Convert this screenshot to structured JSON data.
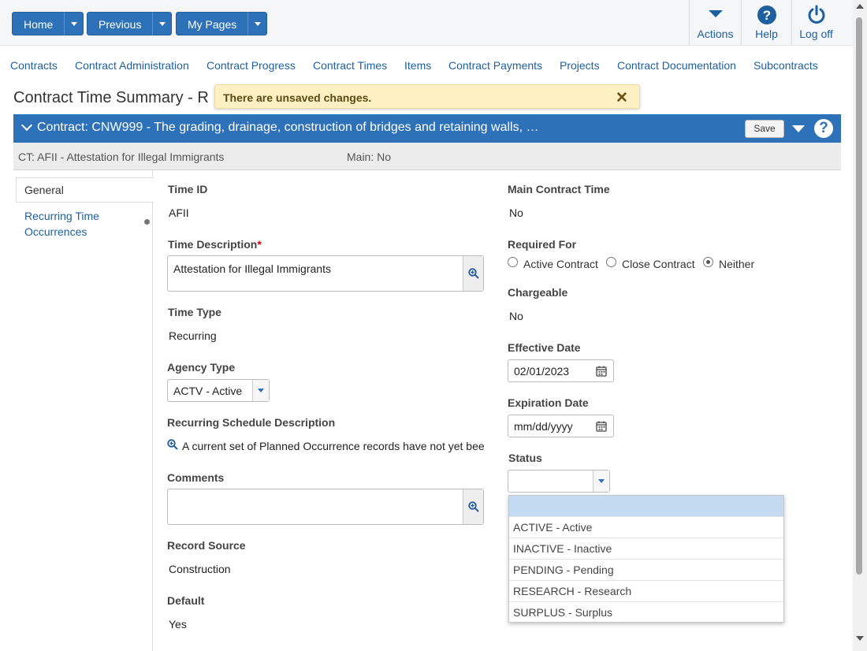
{
  "toolbar": {
    "home": "Home",
    "previous": "Previous",
    "my_pages": "My Pages",
    "actions": "Actions",
    "help": "Help",
    "log_off": "Log off"
  },
  "nav": [
    "Contracts",
    "Contract Administration",
    "Contract Progress",
    "Contract Times",
    "Items",
    "Contract Payments",
    "Projects",
    "Contract Documentation",
    "Subcontracts"
  ],
  "page_title": "Contract Time Summary - R",
  "unsaved_message": "There are unsaved changes.",
  "contract_bar": {
    "title": "Contract: CNW999 - The grading, drainage, construction of bridges and retaining walls, …",
    "save_label": "Save"
  },
  "subinfo": {
    "ct": "CT: AFII - Attestation for Illegal Immigrants",
    "main": "Main: No"
  },
  "side_tabs": {
    "general": "General",
    "recurring": "Recurring Time Occurrences"
  },
  "form": {
    "time_id_label": "Time ID",
    "time_id": "AFII",
    "time_desc_label": "Time Description",
    "time_desc": "Attestation for Illegal Immigrants",
    "time_type_label": "Time Type",
    "time_type": "Recurring",
    "agency_type_label": "Agency Type",
    "agency_type": "ACTV - Active",
    "recurring_sched_label": "Recurring Schedule Description",
    "recurring_sched": "A current set of Planned Occurrence records have not yet bee",
    "comments_label": "Comments",
    "comments": "",
    "record_source_label": "Record Source",
    "record_source": "Construction",
    "default_label": "Default",
    "default": "Yes",
    "main_contract_time_label": "Main Contract Time",
    "main_contract_time": "No",
    "required_for_label": "Required For",
    "required_for_options": [
      "Active Contract",
      "Close Contract",
      "Neither"
    ],
    "required_for_selected": "Neither",
    "chargeable_label": "Chargeable",
    "chargeable": "No",
    "effective_date_label": "Effective Date",
    "effective_date": "02/01/2023",
    "expiration_date_label": "Expiration Date",
    "expiration_date_placeholder": "mm/dd/yyyy",
    "status_label": "Status",
    "status": ""
  },
  "status_options": [
    "",
    "ACTIVE - Active",
    "INACTIVE - Inactive",
    "PENDING - Pending",
    "RESEARCH - Research",
    "SURPLUS - Surplus"
  ],
  "icons": {
    "actions": "chevron-down-icon",
    "help": "question-icon",
    "log_off": "power-icon",
    "zoom": "zoom-in-icon",
    "calendar": "calendar-icon"
  },
  "colors": {
    "primary": "#2d71b8",
    "link": "#1d5f9f",
    "warning_bg": "#fdf0c3",
    "selected_option": "#c4daf1"
  }
}
